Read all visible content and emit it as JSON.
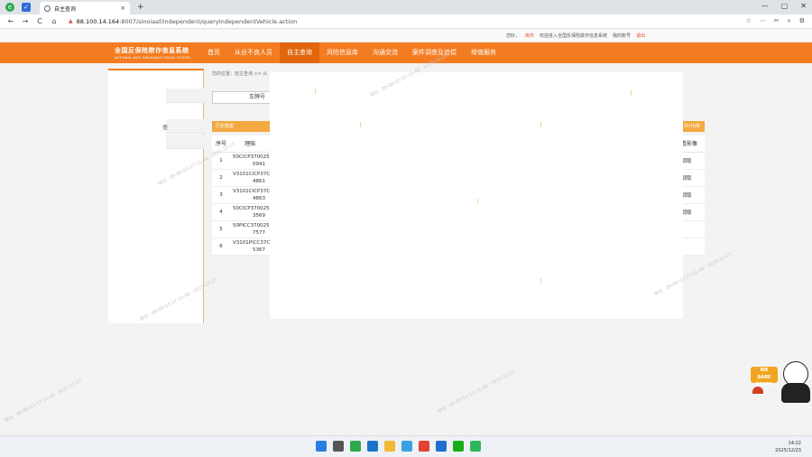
{
  "browser": {
    "tab_title": "自主查询",
    "tab_close": "×",
    "new_tab": "+",
    "url_host": "88.100.14.164",
    "url_rest": ":8007/sinoiaaf/independent/queryIndependentVehicle.action",
    "back": "←",
    "forward": "→",
    "reload": "C",
    "home": "⌂",
    "window_controls": [
      "—",
      "▢",
      "✕"
    ]
  },
  "site": {
    "info": {
      "city_label": "您好，",
      "city": "南市",
      "welcome": "欢迎进入全国反保险欺诈信息系统",
      "account": "我的账号",
      "logout": "退出"
    },
    "logo_cn": "全国反保险欺诈信息系统",
    "logo_en": "NATIONAL ANTI INSURANCE FRAUD SYSTEM",
    "menu": [
      "首页",
      "从业不良人员",
      "自主查询",
      "风险信息库",
      "沟通交流",
      "案件调查及追偿",
      "增值服务"
    ],
    "active_menu": 2
  },
  "sidebar": {
    "row_text": "查"
  },
  "main": {
    "breadcrumb": "您的位置：自主查询 >> 从",
    "plate_label": "车牌号",
    "history_tab": "历史赔案",
    "history_count": "共计6条",
    "columns": {
      "no": "序号",
      "policy": "理赔",
      "action": "查看影像"
    },
    "rows": [
      {
        "no": "1",
        "policy_1": "50CICP370025",
        "policy_2": "0941",
        "action": "调取"
      },
      {
        "no": "2",
        "policy_1": "V3101CICP37C",
        "policy_2": "4861",
        "action": "调取"
      },
      {
        "no": "3",
        "policy_1": "V3101CICP37C",
        "policy_2": "4863",
        "action": "调取"
      },
      {
        "no": "4",
        "policy_1": "50CICP370025",
        "policy_2": "3569",
        "action": "调取"
      },
      {
        "no": "5",
        "policy_1": "50PICC370025",
        "policy_2": "7577",
        "action": ""
      },
      {
        "no": "6",
        "policy_1": "V3101PICC37C",
        "policy_2": "5367",
        "action": ""
      }
    ]
  },
  "watermark": "徐元 · 89-88-03-17-11-48 · 2025-12-23",
  "mascot": {
    "sign_1": "WE",
    "sign_2": "BARE",
    "sign_3": "BEARS"
  },
  "taskbar": {
    "time": "14:22",
    "date": "2025/12/23"
  },
  "colors": {
    "brand_orange": "#f47c20",
    "history_orange": "#f4a940",
    "alert_red": "#e74c2c"
  }
}
